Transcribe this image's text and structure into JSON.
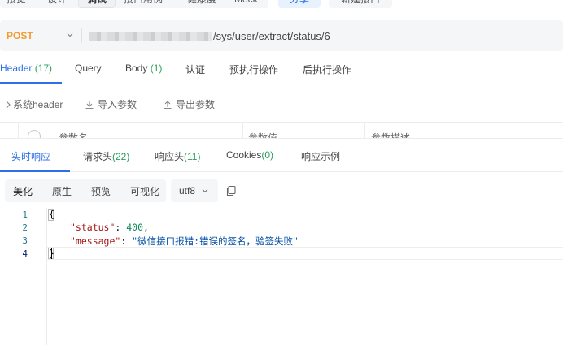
{
  "top_tabs": {
    "items": [
      "接览",
      "设计",
      "调试",
      "接口用例",
      "健康度",
      "Mock"
    ],
    "share_label": "分享",
    "new_interface_label": "新建接口"
  },
  "request": {
    "method": "POST",
    "url_visible": "/sys/user/extract/status/6"
  },
  "request_tabs": [
    {
      "label": "Header",
      "count": "(17)"
    },
    {
      "label": "Query",
      "count": ""
    },
    {
      "label": "Body",
      "count": "(1)"
    },
    {
      "label": "认证",
      "count": ""
    },
    {
      "label": "预执行操作",
      "count": ""
    },
    {
      "label": "后执行操作",
      "count": ""
    }
  ],
  "header_tools": {
    "system_header": "系统header",
    "import_params": "导入参数",
    "export_params": "导出参数"
  },
  "param_columns": [
    "参数名",
    "参数值",
    "参数描述"
  ],
  "response_tabs": [
    {
      "label": "实时响应",
      "count": ""
    },
    {
      "label": "请求头",
      "count": "(22)"
    },
    {
      "label": "响应头",
      "count": "(11)"
    },
    {
      "label": "Cookies",
      "count": "(0)"
    },
    {
      "label": "响应示例",
      "count": ""
    }
  ],
  "view_modes": [
    "美化",
    "原生",
    "预览",
    "可视化"
  ],
  "encoding": "utf8",
  "code": {
    "line_numbers": [
      "1",
      "2",
      "3",
      "4"
    ],
    "open_brace": "{",
    "status_key": "\"status\"",
    "status_value": "400",
    "message_key": "\"message\"",
    "message_value": "\"微信接口报错:错误的签名，验签失败\"",
    "close_brace": "}"
  },
  "colors": {
    "accent": "#2c6fe6",
    "method_post": "#f39b2e",
    "count_green": "#27a05a"
  }
}
